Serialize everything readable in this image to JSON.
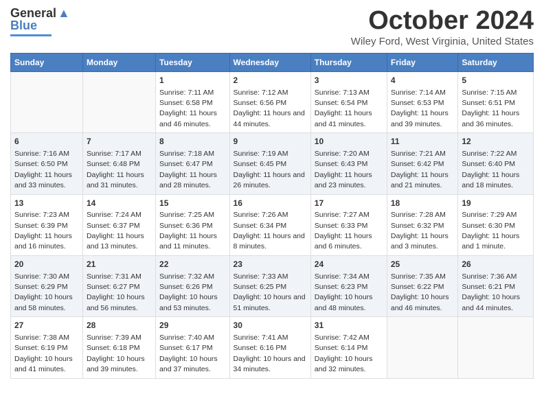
{
  "logo": {
    "line1": "General",
    "line2": "Blue"
  },
  "title": "October 2024",
  "location": "Wiley Ford, West Virginia, United States",
  "days_of_week": [
    "Sunday",
    "Monday",
    "Tuesday",
    "Wednesday",
    "Thursday",
    "Friday",
    "Saturday"
  ],
  "weeks": [
    [
      {
        "day": "",
        "info": ""
      },
      {
        "day": "",
        "info": ""
      },
      {
        "day": "1",
        "info": "Sunrise: 7:11 AM\nSunset: 6:58 PM\nDaylight: 11 hours and 46 minutes."
      },
      {
        "day": "2",
        "info": "Sunrise: 7:12 AM\nSunset: 6:56 PM\nDaylight: 11 hours and 44 minutes."
      },
      {
        "day": "3",
        "info": "Sunrise: 7:13 AM\nSunset: 6:54 PM\nDaylight: 11 hours and 41 minutes."
      },
      {
        "day": "4",
        "info": "Sunrise: 7:14 AM\nSunset: 6:53 PM\nDaylight: 11 hours and 39 minutes."
      },
      {
        "day": "5",
        "info": "Sunrise: 7:15 AM\nSunset: 6:51 PM\nDaylight: 11 hours and 36 minutes."
      }
    ],
    [
      {
        "day": "6",
        "info": "Sunrise: 7:16 AM\nSunset: 6:50 PM\nDaylight: 11 hours and 33 minutes."
      },
      {
        "day": "7",
        "info": "Sunrise: 7:17 AM\nSunset: 6:48 PM\nDaylight: 11 hours and 31 minutes."
      },
      {
        "day": "8",
        "info": "Sunrise: 7:18 AM\nSunset: 6:47 PM\nDaylight: 11 hours and 28 minutes."
      },
      {
        "day": "9",
        "info": "Sunrise: 7:19 AM\nSunset: 6:45 PM\nDaylight: 11 hours and 26 minutes."
      },
      {
        "day": "10",
        "info": "Sunrise: 7:20 AM\nSunset: 6:43 PM\nDaylight: 11 hours and 23 minutes."
      },
      {
        "day": "11",
        "info": "Sunrise: 7:21 AM\nSunset: 6:42 PM\nDaylight: 11 hours and 21 minutes."
      },
      {
        "day": "12",
        "info": "Sunrise: 7:22 AM\nSunset: 6:40 PM\nDaylight: 11 hours and 18 minutes."
      }
    ],
    [
      {
        "day": "13",
        "info": "Sunrise: 7:23 AM\nSunset: 6:39 PM\nDaylight: 11 hours and 16 minutes."
      },
      {
        "day": "14",
        "info": "Sunrise: 7:24 AM\nSunset: 6:37 PM\nDaylight: 11 hours and 13 minutes."
      },
      {
        "day": "15",
        "info": "Sunrise: 7:25 AM\nSunset: 6:36 PM\nDaylight: 11 hours and 11 minutes."
      },
      {
        "day": "16",
        "info": "Sunrise: 7:26 AM\nSunset: 6:34 PM\nDaylight: 11 hours and 8 minutes."
      },
      {
        "day": "17",
        "info": "Sunrise: 7:27 AM\nSunset: 6:33 PM\nDaylight: 11 hours and 6 minutes."
      },
      {
        "day": "18",
        "info": "Sunrise: 7:28 AM\nSunset: 6:32 PM\nDaylight: 11 hours and 3 minutes."
      },
      {
        "day": "19",
        "info": "Sunrise: 7:29 AM\nSunset: 6:30 PM\nDaylight: 11 hours and 1 minute."
      }
    ],
    [
      {
        "day": "20",
        "info": "Sunrise: 7:30 AM\nSunset: 6:29 PM\nDaylight: 10 hours and 58 minutes."
      },
      {
        "day": "21",
        "info": "Sunrise: 7:31 AM\nSunset: 6:27 PM\nDaylight: 10 hours and 56 minutes."
      },
      {
        "day": "22",
        "info": "Sunrise: 7:32 AM\nSunset: 6:26 PM\nDaylight: 10 hours and 53 minutes."
      },
      {
        "day": "23",
        "info": "Sunrise: 7:33 AM\nSunset: 6:25 PM\nDaylight: 10 hours and 51 minutes."
      },
      {
        "day": "24",
        "info": "Sunrise: 7:34 AM\nSunset: 6:23 PM\nDaylight: 10 hours and 48 minutes."
      },
      {
        "day": "25",
        "info": "Sunrise: 7:35 AM\nSunset: 6:22 PM\nDaylight: 10 hours and 46 minutes."
      },
      {
        "day": "26",
        "info": "Sunrise: 7:36 AM\nSunset: 6:21 PM\nDaylight: 10 hours and 44 minutes."
      }
    ],
    [
      {
        "day": "27",
        "info": "Sunrise: 7:38 AM\nSunset: 6:19 PM\nDaylight: 10 hours and 41 minutes."
      },
      {
        "day": "28",
        "info": "Sunrise: 7:39 AM\nSunset: 6:18 PM\nDaylight: 10 hours and 39 minutes."
      },
      {
        "day": "29",
        "info": "Sunrise: 7:40 AM\nSunset: 6:17 PM\nDaylight: 10 hours and 37 minutes."
      },
      {
        "day": "30",
        "info": "Sunrise: 7:41 AM\nSunset: 6:16 PM\nDaylight: 10 hours and 34 minutes."
      },
      {
        "day": "31",
        "info": "Sunrise: 7:42 AM\nSunset: 6:14 PM\nDaylight: 10 hours and 32 minutes."
      },
      {
        "day": "",
        "info": ""
      },
      {
        "day": "",
        "info": ""
      }
    ]
  ]
}
